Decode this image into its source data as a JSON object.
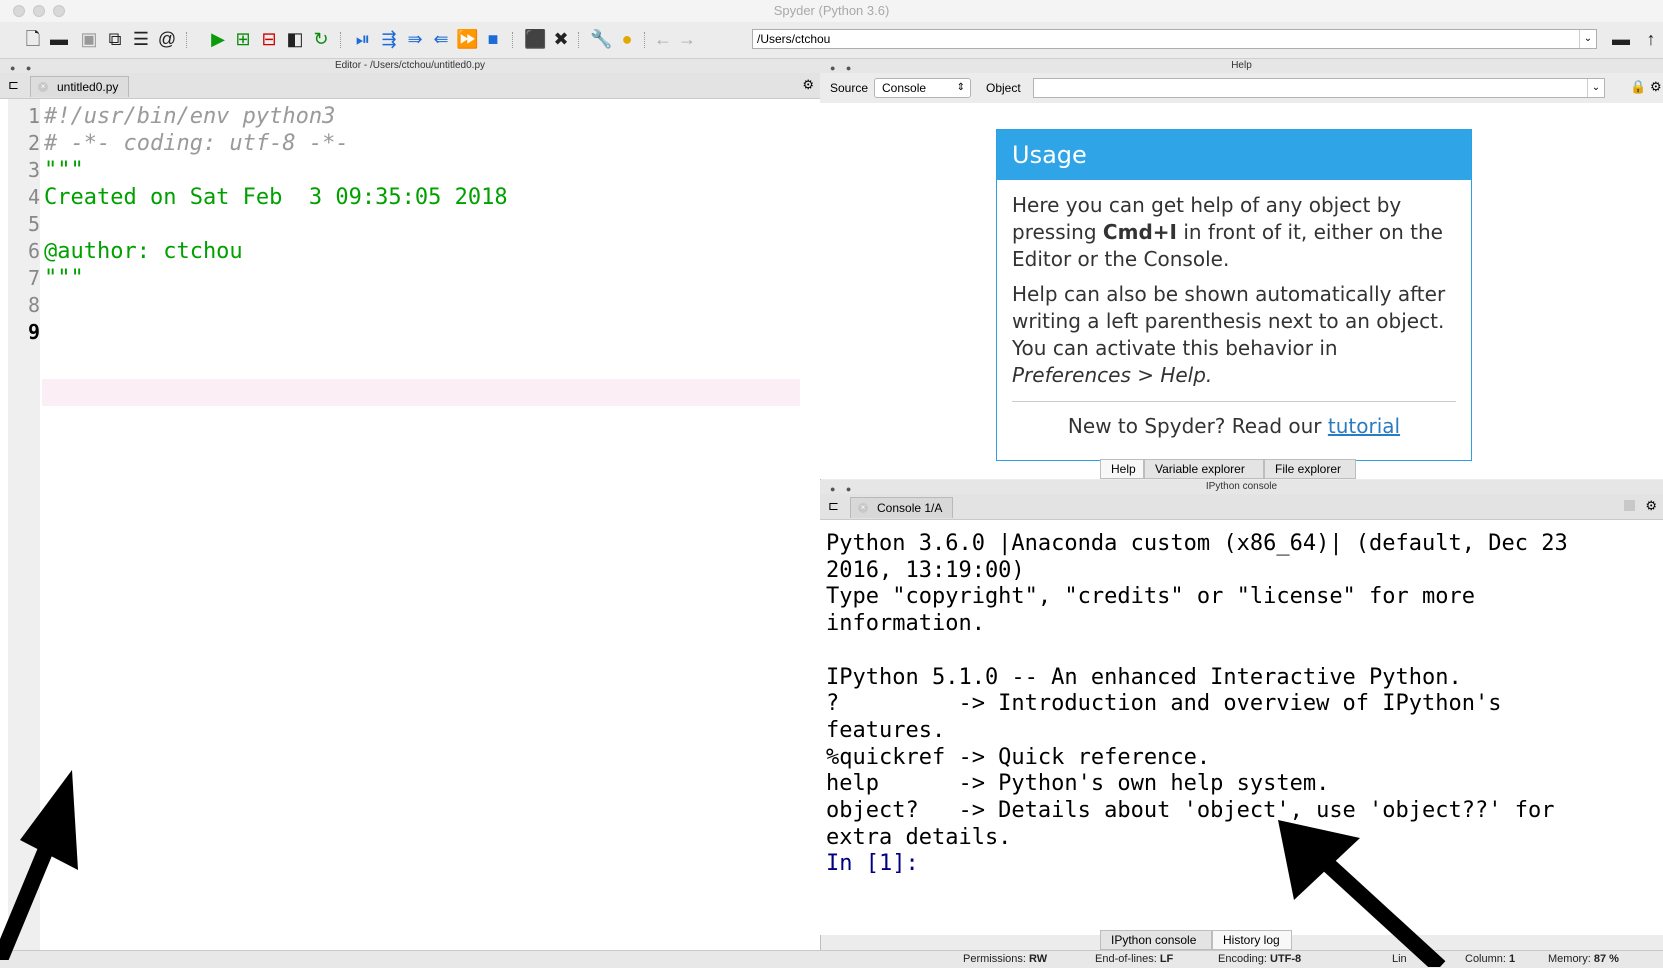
{
  "window": {
    "title": "Spyder (Python 3.6)"
  },
  "toolbar": {
    "path": "/Users/ctchou"
  },
  "editor": {
    "header": "Editor - /Users/ctchou/untitled0.py",
    "tab": "untitled0.py",
    "line_numbers": [
      "1",
      "2",
      "3",
      "4",
      "5",
      "6",
      "7",
      "8",
      "9"
    ],
    "lines": [
      "#!/usr/bin/env python3",
      "# -*- coding: utf-8 -*-",
      "\"\"\"",
      "Created on Sat Feb  3 09:35:05 2018",
      "",
      "@author: ctchou",
      "\"\"\"",
      "",
      ""
    ]
  },
  "help": {
    "header": "Help",
    "source_label": "Source",
    "source_value": "Console",
    "object_label": "Object",
    "usage_title": "Usage",
    "usage_p1_a": "Here you can get help of any object by pressing ",
    "usage_p1_key": "Cmd+I",
    "usage_p1_b": " in front of it, either on the Editor or the Console.",
    "usage_p2_a": "Help can also be shown automatically after writing a left parenthesis next to an object. You can activate this behavior in ",
    "usage_p2_pref": "Preferences > Help.",
    "usage_new": "New to Spyder? Read our ",
    "usage_link": "tutorial",
    "tabs": [
      "Help",
      "Variable explorer",
      "File explorer"
    ]
  },
  "console": {
    "header": "IPython console",
    "tab": "Console 1/A",
    "output": "Python 3.6.0 |Anaconda custom (x86_64)| (default, Dec 23\n2016, 13:19:00)\nType \"copyright\", \"credits\" or \"license\" for more\ninformation.\n\nIPython 5.1.0 -- An enhanced Interactive Python.\n?         -> Introduction and overview of IPython's\nfeatures.\n%quickref -> Quick reference.\nhelp      -> Python's own help system.\nobject?   -> Details about 'object', use 'object??' for\nextra details.\n",
    "prompt": "In [1]:",
    "tabs": [
      "IPython console",
      "History log"
    ]
  },
  "status": {
    "permissions_label": "Permissions:",
    "permissions_value": "RW",
    "eol_label": "End-of-lines:",
    "eol_value": "LF",
    "encoding_label": "Encoding:",
    "encoding_value": "UTF-8",
    "line_label": "Lin",
    "column_label": "Column:",
    "column_value": "1",
    "memory_label": "Memory:",
    "memory_value": "87 %"
  },
  "colors": {
    "accent": "#2fa4e7",
    "string": "#00a000",
    "comment": "#9a9a9a"
  }
}
